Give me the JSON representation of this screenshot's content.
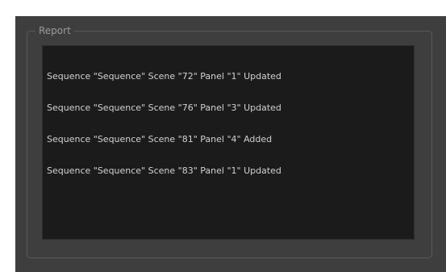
{
  "report": {
    "title": "Report",
    "lines": [
      "Sequence \"Sequence\" Scene \"72\" Panel \"1\" Updated",
      "Sequence \"Sequence\" Scene \"76\" Panel \"3\" Updated",
      "Sequence \"Sequence\" Scene \"81\" Panel \"4\" Added",
      "Sequence \"Sequence\" Scene \"83\" Panel \"1\" Updated"
    ]
  }
}
